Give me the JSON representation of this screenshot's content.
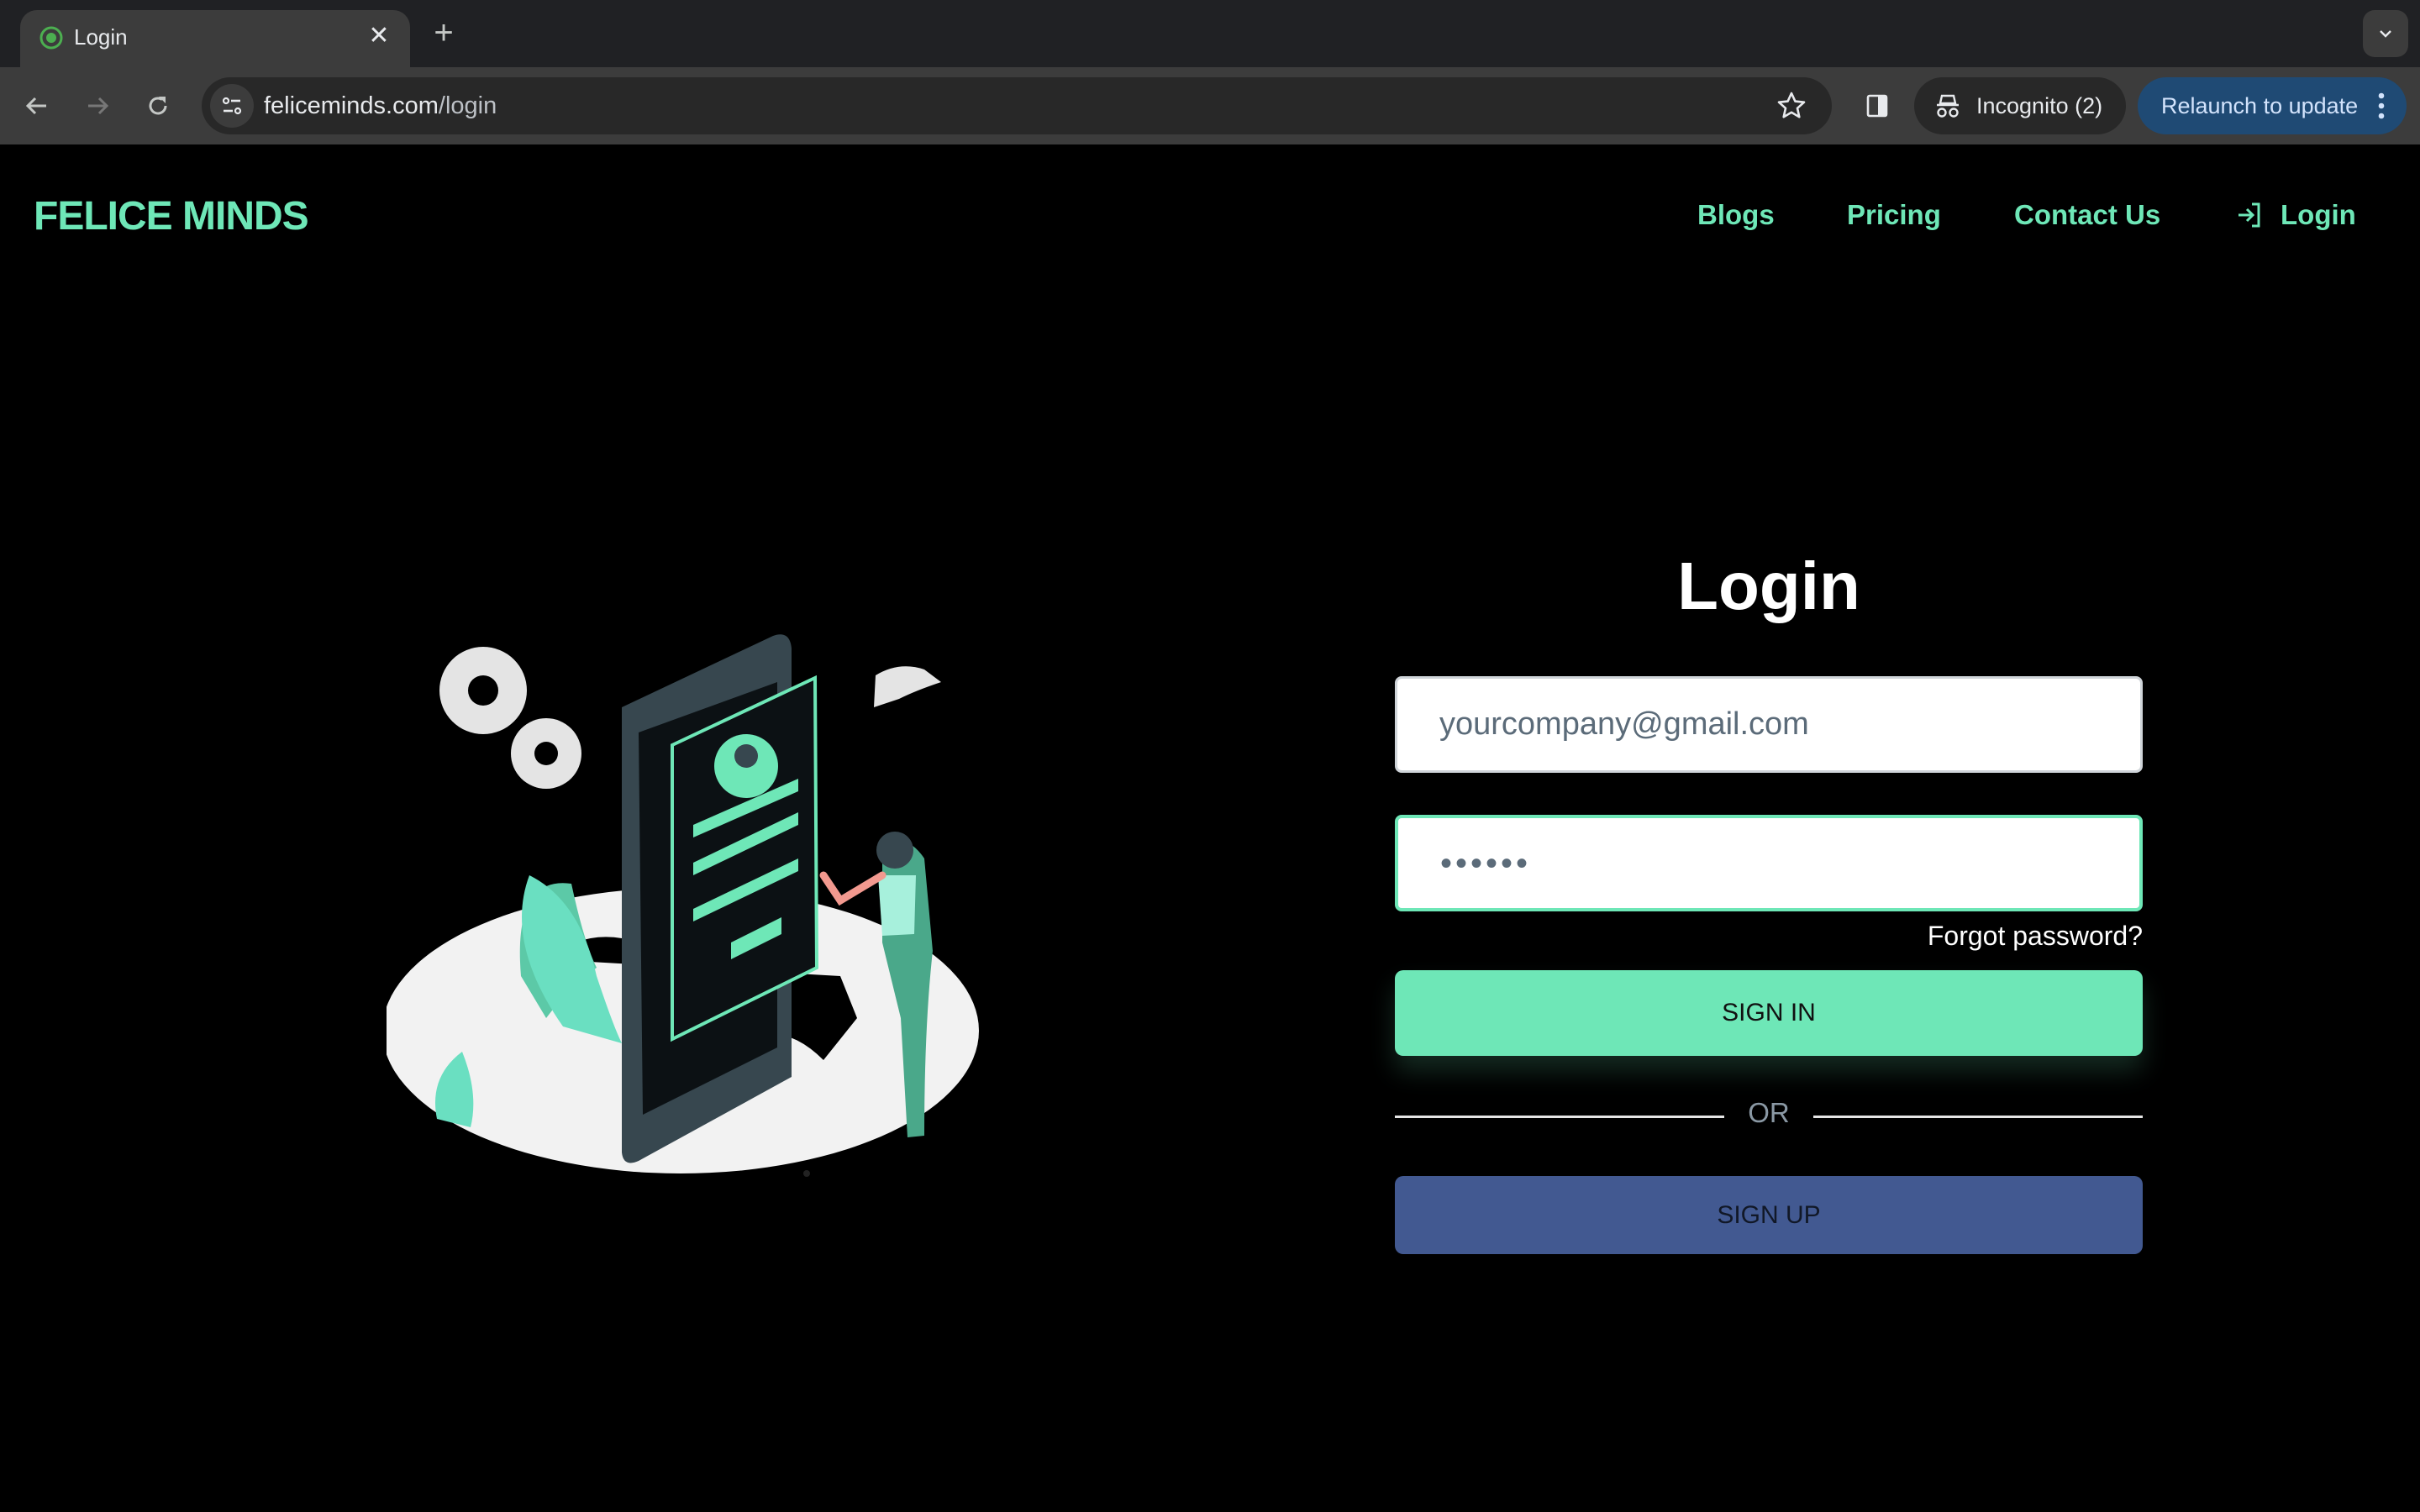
{
  "browser": {
    "tab": {
      "title": "Login",
      "favicon": "felice-minds-favicon",
      "close_icon": "close-icon"
    },
    "new_tab_icon": "plus-icon",
    "tab_search_icon": "chevron-down-icon",
    "address_bar": {
      "domain": "feliceminds.com",
      "path": "/login"
    },
    "incognito_label": "Incognito (2)",
    "relaunch_label": "Relaunch to update"
  },
  "site": {
    "brand": "FELICE MINDS",
    "nav": [
      {
        "label": "Blogs"
      },
      {
        "label": "Pricing"
      },
      {
        "label": "Contact Us"
      },
      {
        "label": "Login",
        "icon": "login-icon"
      }
    ],
    "form": {
      "title": "Login",
      "email_value": "yourcompany@gmail.com",
      "password_masked": "••••••",
      "forgot_label": "Forgot password?",
      "signin_label": "SIGN IN",
      "divider_label": "OR",
      "signup_label": "SIGN UP"
    },
    "illustration": "login-illustration"
  },
  "colors": {
    "accent": "#6ee7b7",
    "signup": "#425991",
    "relaunch": "#1f4a74",
    "background": "#000000"
  }
}
